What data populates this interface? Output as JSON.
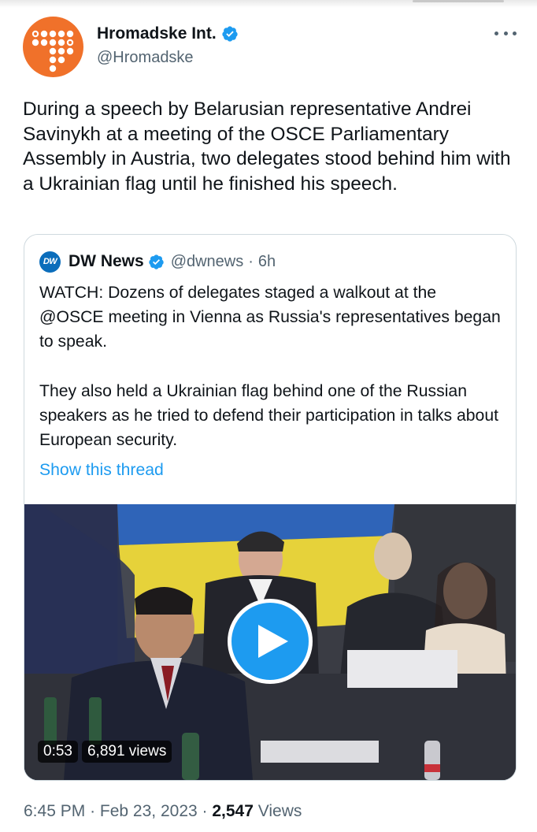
{
  "tweet": {
    "author_name": "Hromadske Int.",
    "author_handle": "@Hromadske",
    "text": "During a speech by Belarusian representative Andrei Savinykh at a meeting of the OSCE Parliamentary Assembly in Austria, two delegates stood behind him with a Ukrainian flag until he finished his speech.",
    "time": "6:45 PM",
    "date": "Feb 23, 2023",
    "separator": "·",
    "view_count": "2,547",
    "views_label": "Views"
  },
  "quote": {
    "logo_text": "DW",
    "author_name": "DW News",
    "author_handle": "@dwnews",
    "separator": "·",
    "age": "6h",
    "paragraph1": "WATCH: Dozens of delegates staged a walkout at the @OSCE meeting in Vienna as Russia's representatives began to speak.",
    "paragraph2": "They also held a Ukrainian flag behind one of the Russian speakers as he tried to defend their participation in talks about European security.",
    "show_thread": "Show this thread",
    "video": {
      "duration": "0:53",
      "views": "6,891 views"
    }
  },
  "icons": {
    "verified": "verified-badge-icon",
    "more": "more-options-icon",
    "play": "play-icon",
    "avatar": "hromadske-logo"
  },
  "colors": {
    "accent": "#1d9bf0",
    "avatar_bg": "#f0712a",
    "dw_blue": "#0b6dbb",
    "secondary_text": "#536471"
  }
}
